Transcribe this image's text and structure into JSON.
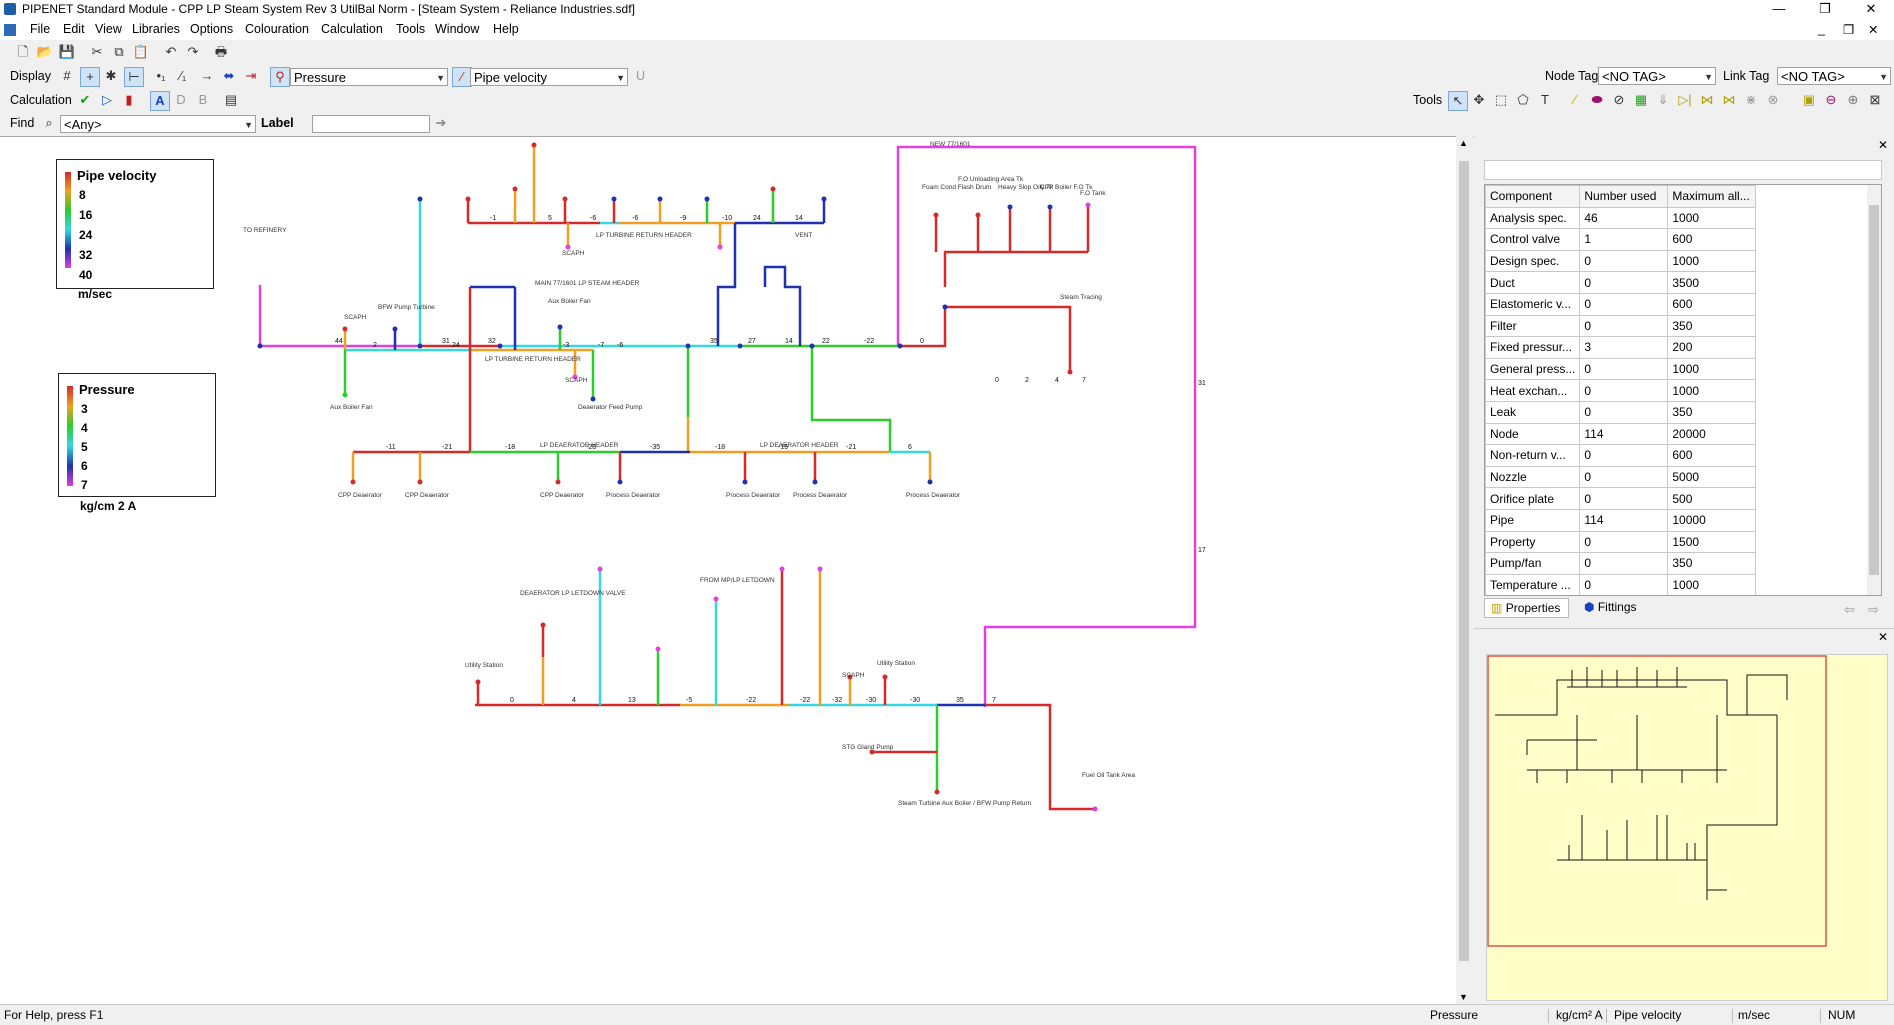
{
  "window": {
    "title": "PIPENET Standard Module - CPP LP Steam System Rev 3 UtilBal Norm - [Steam System - Reliance Industries.sdf]"
  },
  "menu": [
    "File",
    "Edit",
    "View",
    "Libraries",
    "Options",
    "Colouration",
    "Calculation",
    "Tools",
    "Window",
    "Help"
  ],
  "toolbar": {
    "display_label": "Display",
    "node_colouring": "Pressure",
    "link_colouring": "Pipe velocity",
    "u_label": "U",
    "node_tag_label": "Node Tag",
    "node_tag_value": "<NO TAG>",
    "link_tag_label": "Link Tag",
    "link_tag_value": "<NO TAG>",
    "calculation_label": "Calculation",
    "calc_a": "A",
    "calc_d": "D",
    "calc_b": "B",
    "tools_label": "Tools",
    "find_label": "Find",
    "find_value": "<Any>",
    "label_label": "Label",
    "label_value": ""
  },
  "legend_velocity": {
    "title": "Pipe velocity",
    "values": [
      "8",
      "16",
      "24",
      "32",
      "40"
    ],
    "unit": "m/sec"
  },
  "legend_pressure": {
    "title": "Pressure",
    "values": [
      "3",
      "4",
      "5",
      "6",
      "7"
    ],
    "unit": "kg/cm 2 A"
  },
  "schematic": {
    "labels": [
      "TO REFINERY",
      "MAIN 77/1601 LP STEAM HEADER",
      "LP TURBINE RETURN HEADER",
      "LP DEAERATOR HEADER",
      "SCAPH",
      "VENT",
      "Steam Tracing",
      "NEW 77/1601",
      "FROM MP/LP LETDOWN",
      "DEAERATOR LP LETDOWN VALVE",
      "Utility Station",
      "STG Gland Pump",
      "Fuel Oil Tank Area",
      "Steam Turbine Aux Boiler / BFW Pump Return",
      "CPP Deaerator",
      "Process Deaerator",
      "Deaerator Feed Pump",
      "Aux Boiler Fan",
      "BFW Pump Turbine",
      "F.O Unloading Area Tk",
      "Heavy Slop Oily Tk",
      "Foam Cond Flash Drum",
      "F.O Tank",
      "CPP Boiler F.O Tk"
    ]
  },
  "properties": {
    "headers": [
      "Component",
      "Number used",
      "Maximum all..."
    ],
    "rows": [
      [
        "Analysis spec.",
        "46",
        "1000"
      ],
      [
        "Control valve",
        "1",
        "600"
      ],
      [
        "Design spec.",
        "0",
        "1000"
      ],
      [
        "Duct",
        "0",
        "3500"
      ],
      [
        "Elastomeric v...",
        "0",
        "600"
      ],
      [
        "Filter",
        "0",
        "350"
      ],
      [
        "Fixed pressur...",
        "3",
        "200"
      ],
      [
        "General press...",
        "0",
        "1000"
      ],
      [
        "Heat exchan...",
        "0",
        "1000"
      ],
      [
        "Leak",
        "0",
        "350"
      ],
      [
        "Node",
        "114",
        "20000"
      ],
      [
        "Non-return v...",
        "0",
        "600"
      ],
      [
        "Nozzle",
        "0",
        "5000"
      ],
      [
        "Orifice plate",
        "0",
        "500"
      ],
      [
        "Pipe",
        "114",
        "10000"
      ],
      [
        "Property",
        "0",
        "1500"
      ],
      [
        "Pump/fan",
        "0",
        "350"
      ],
      [
        "Temperature ...",
        "0",
        "1000"
      ]
    ],
    "tab_properties": "Properties",
    "tab_fittings": "Fittings"
  },
  "status": {
    "help": "For Help, press F1",
    "node_var": "Pressure",
    "node_unit": "kg/cm² A",
    "link_var": "Pipe velocity",
    "link_unit": "m/sec",
    "num": "NUM"
  },
  "colors": {
    "red": "#d42a2a",
    "orange": "#f0a020",
    "green": "#2ccd2c",
    "cyan": "#34d8e0",
    "blue": "#2030b0",
    "magenta": "#e040e0",
    "grey": "#a0a0a0"
  }
}
